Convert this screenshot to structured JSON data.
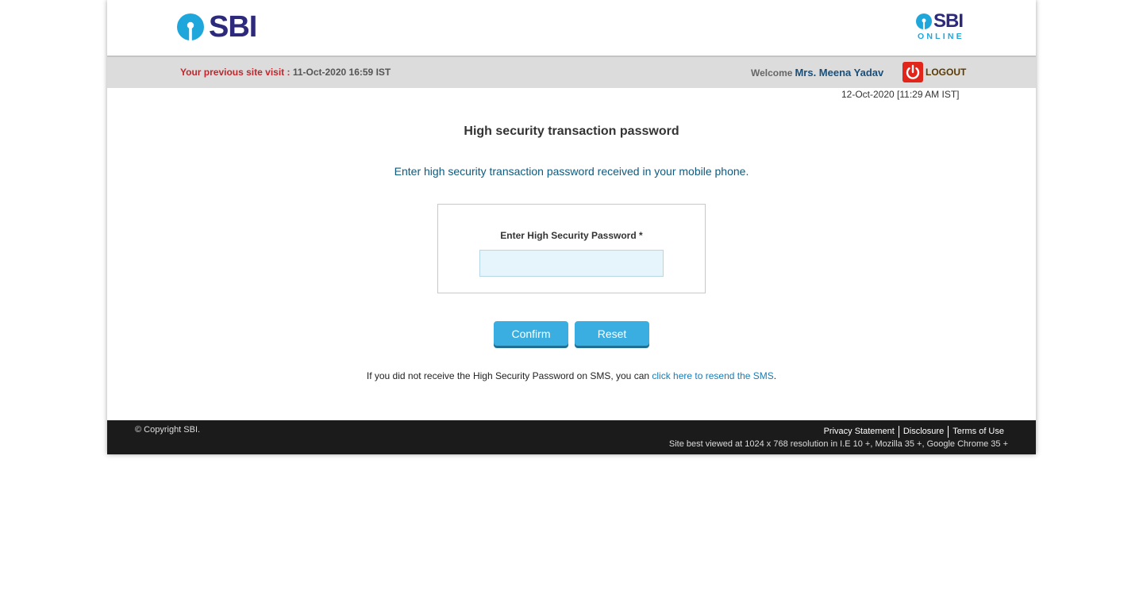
{
  "header": {
    "logo_left_text": "SBI",
    "logo_right_text": "SBI",
    "logo_right_subtext": "ONLINE",
    "brand_color": "#2d2a7c",
    "accent_color": "#1fa7db"
  },
  "infobar": {
    "prev_visit_label": "Your previous site visit :",
    "prev_visit_value": "11-Oct-2020 16:59 IST",
    "welcome_label": "Welcome",
    "user_name": "Mrs. Meena Yadav",
    "logout_label": "LOGOUT",
    "logout_icon": "power-icon"
  },
  "datetime": "12-Oct-2020 [11:29 AM IST]",
  "main": {
    "title": "High security transaction password",
    "instruction": "Enter high security transaction password received in your mobile phone.",
    "password_label": "Enter High Security Password *",
    "password_value": "",
    "confirm_label": "Confirm",
    "reset_label": "Reset",
    "resend_text": "If you did not receive the High Security Password on SMS, you can",
    "resend_link": "click here to resend the SMS",
    "resend_suffix": "."
  },
  "footer": {
    "copyright": "© Copyright SBI.",
    "links": [
      "Privacy Statement",
      "Disclosure",
      "Terms of Use"
    ],
    "best_viewed": "Site best viewed at 1024 x 768 resolution in I.E 10 +, Mozilla 35 +, Google Chrome 35 +"
  }
}
